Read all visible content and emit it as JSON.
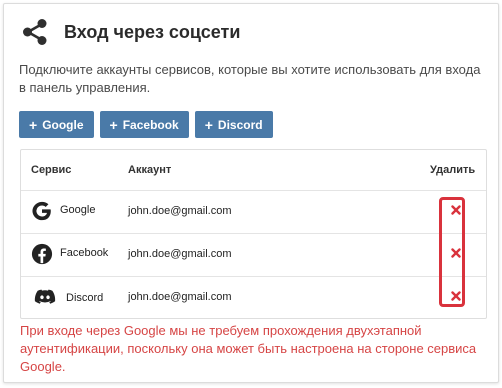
{
  "header": {
    "title": "Вход через соцсети",
    "icon": "share-icon"
  },
  "description": "Подключите аккаунты сервисов, которые вы хотите использовать для входа в панель управления.",
  "buttons": [
    {
      "plus": "+",
      "label": "Google"
    },
    {
      "plus": "+",
      "label": "Facebook"
    },
    {
      "plus": "+",
      "label": "Discord"
    }
  ],
  "table": {
    "headers": {
      "service": "Сервис",
      "account": "Аккаунт",
      "delete": "Удалить"
    },
    "rows": [
      {
        "service": "Google",
        "icon": "google-icon",
        "account": "john.doe@gmail.com"
      },
      {
        "service": "Facebook",
        "icon": "facebook-icon",
        "account": "john.doe@gmail.com"
      },
      {
        "service": "Discord",
        "icon": "discord-icon",
        "account": "john.doe@gmail.com"
      }
    ]
  },
  "note": "При входе через Google мы не требуем прохождения двухэтапной аутентификации, поскольку она может быть настроена на стороне сервиса Google.",
  "colors": {
    "button": "#4a7aa8",
    "delete": "#d9323c",
    "note": "#d64545"
  }
}
